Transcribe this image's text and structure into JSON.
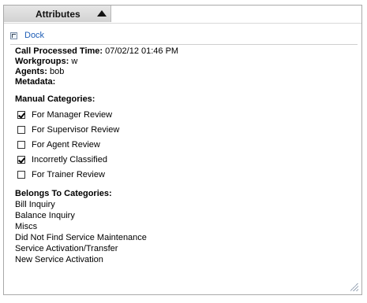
{
  "panel": {
    "tab_title": "Attributes",
    "dock_label": "Dock"
  },
  "info": {
    "call_processed_label": "Call Processed Time:",
    "call_processed_value": "07/02/12 01:46 PM",
    "workgroups_label": "Workgroups:",
    "workgroups_value": "w",
    "agents_label": "Agents:",
    "agents_value": "bob",
    "metadata_label": "Metadata:"
  },
  "manual_categories": {
    "heading": "Manual Categories:",
    "items": [
      {
        "label": "For Manager Review",
        "checked": true
      },
      {
        "label": "For Supervisor Review",
        "checked": false
      },
      {
        "label": "For Agent Review",
        "checked": false
      },
      {
        "label": "Incorretly Classified",
        "checked": true
      },
      {
        "label": "For Trainer Review",
        "checked": false
      }
    ]
  },
  "belongs_to": {
    "heading": "Belongs To Categories:",
    "items": [
      "Bill Inquiry",
      "Balance Inquiry",
      "Miscs",
      "Did Not Find Service Maintenance",
      "Service Activation/Transfer",
      "New Service Activation"
    ]
  }
}
